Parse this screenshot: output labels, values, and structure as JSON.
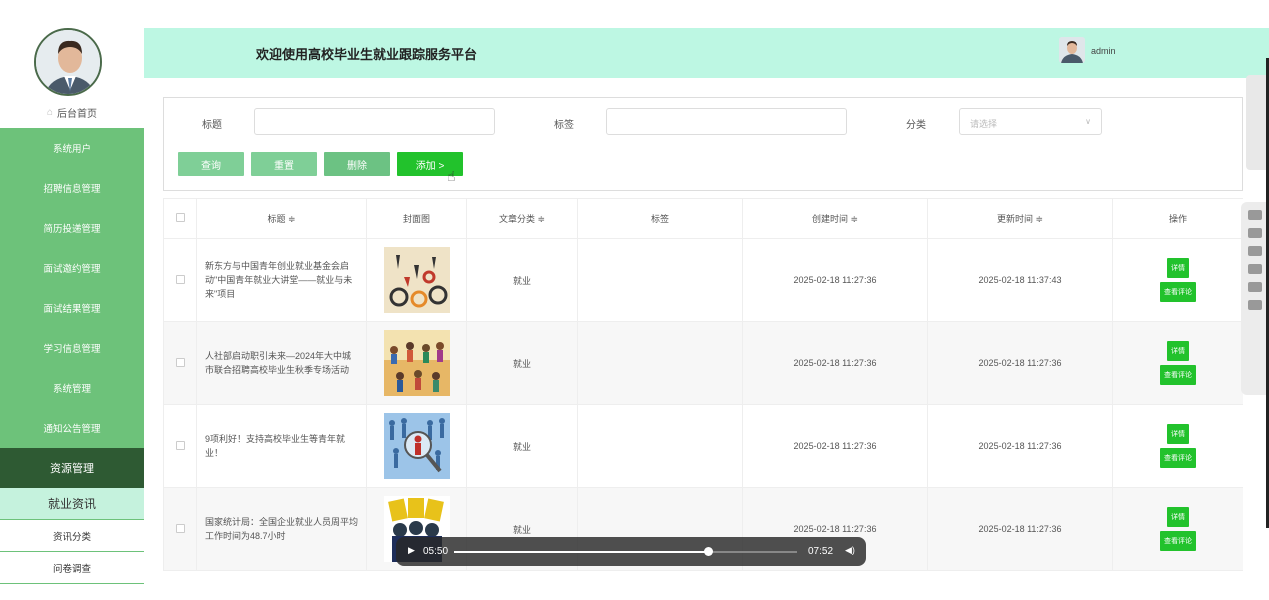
{
  "header": {
    "title": "欢迎使用高校毕业生就业跟踪服务平台",
    "username": "admin"
  },
  "sidebar": {
    "home": "后台首页",
    "items": [
      {
        "label": "系统用户"
      },
      {
        "label": "招聘信息管理"
      },
      {
        "label": "简历投递管理"
      },
      {
        "label": "面试邀约管理"
      },
      {
        "label": "面试结果管理"
      },
      {
        "label": "学习信息管理"
      },
      {
        "label": "系统管理"
      },
      {
        "label": "通知公告管理"
      },
      {
        "label": "资源管理"
      }
    ],
    "sub_items": [
      {
        "label": "就业资讯"
      },
      {
        "label": "资讯分类"
      },
      {
        "label": "问卷调查"
      }
    ]
  },
  "search": {
    "title_label": "标题",
    "tag_label": "标签",
    "category_label": "分类",
    "category_placeholder": "请选择",
    "query_btn": "查询",
    "reset_btn": "重置",
    "delete_btn": "删除",
    "add_btn": "添加 >"
  },
  "table": {
    "headers": [
      "标题 ≑",
      "封面图",
      "文章分类 ≑",
      "标签",
      "创建时间 ≑",
      "更新时间 ≑",
      "操作"
    ],
    "detail_label": "详情",
    "comment_label": "查看评论",
    "rows": [
      {
        "title": "新东方与中国青年创业就业基金会启动\"中国青年就业大讲堂——就业与未来\"项目",
        "category": "就业",
        "tag": "",
        "created": "2025-02-18 11:27:36",
        "updated": "2025-02-18 11:37:43"
      },
      {
        "title": "人社部启动职引未来—2024年大中城市联合招聘高校毕业生秋季专场活动",
        "category": "就业",
        "tag": "",
        "created": "2025-02-18 11:27:36",
        "updated": "2025-02-18 11:27:36"
      },
      {
        "title": "9项利好！支持高校毕业生等青年就业！",
        "category": "就业",
        "tag": "",
        "created": "2025-02-18 11:27:36",
        "updated": "2025-02-18 11:27:36"
      },
      {
        "title": "国家统计局：全国企业就业人员周平均工作时间为48.7小时",
        "category": "就业",
        "tag": "",
        "created": "2025-02-18 11:27:36",
        "updated": "2025-02-18 11:27:36"
      }
    ]
  },
  "video": {
    "current": "05:50",
    "total": "07:52",
    "progress": 0.74
  },
  "colors": {
    "header_bg": "#bdf7e3",
    "menu_green": "#6dc27a",
    "menu_dark": "#2e5a33",
    "button_green": "#22c22c"
  }
}
